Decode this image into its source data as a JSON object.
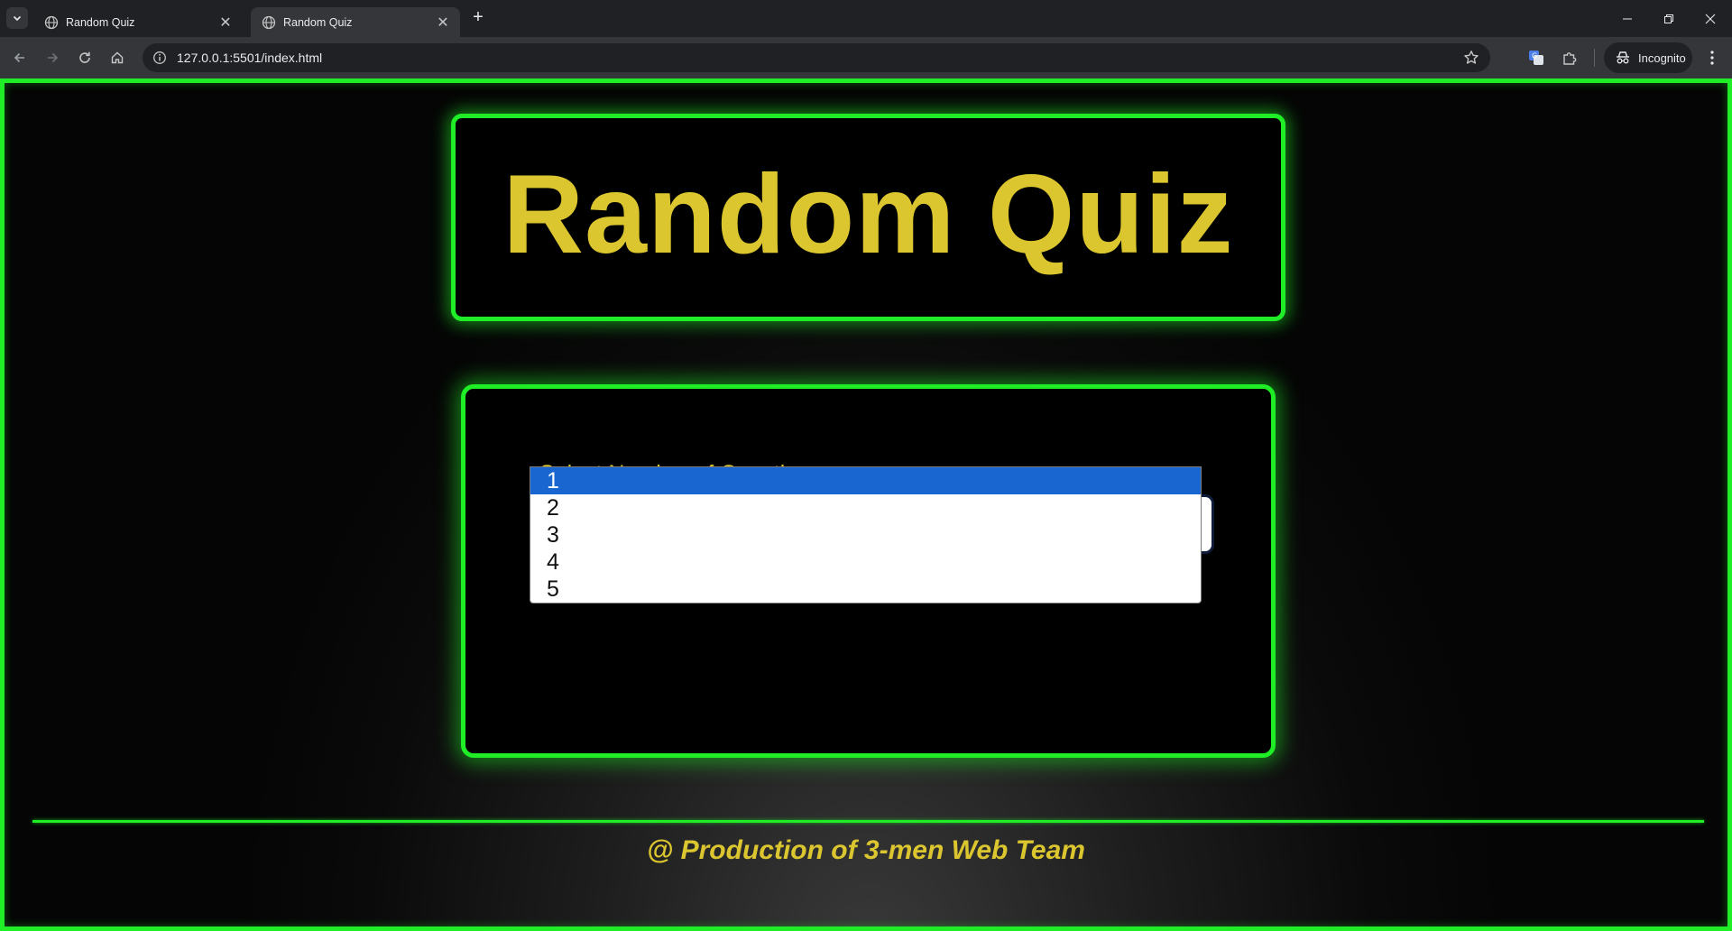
{
  "browser": {
    "tabs": [
      {
        "title": "Random Quiz",
        "active": false
      },
      {
        "title": "Random Quiz",
        "active": true
      }
    ],
    "url": "127.0.0.1:5501/index.html",
    "profile_label": "Incognito"
  },
  "page": {
    "heading": "Random Quiz",
    "select_label": "Select Number of Questions",
    "selected_value": "1",
    "options": [
      "1",
      "2",
      "3",
      "4",
      "5"
    ],
    "footer": "@ Production of 3-men Web Team"
  },
  "colors": {
    "accent_green": "#1fee26",
    "title_yellow": "#dcc62f",
    "option_highlight": "#1a66d0"
  },
  "icons": {
    "tab_favicon": "globe-icon",
    "select_arrow": "chevron-down-icon"
  }
}
